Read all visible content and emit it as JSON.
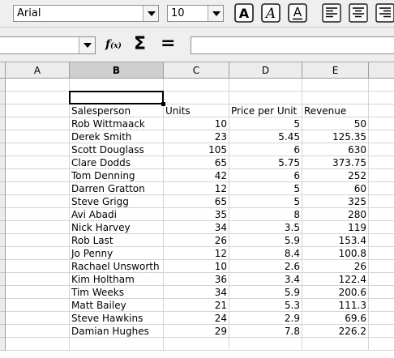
{
  "toolbar": {
    "font_name": "Arial",
    "font_size": "10",
    "bold_icon": "bold-icon",
    "italic_icon": "italic-icon",
    "underline_icon": "underline-icon",
    "bold_letter": "A",
    "italic_letter": "A",
    "underline_letter": "A"
  },
  "formula_bar": {
    "name_box_value": "",
    "function_wizard_label": "f(x)",
    "sum_label": "Σ",
    "equals_label": "=",
    "input_value": ""
  },
  "columns": [
    "A",
    "B",
    "C",
    "D",
    "E"
  ],
  "selected_column": "B",
  "headers": {
    "salesperson": "Salesperson",
    "units": "Units",
    "price": "Price per Unit",
    "revenue": "Revenue"
  },
  "rows": [
    {
      "name": "Rob Wittmaack",
      "units": "10",
      "price": "5",
      "revenue": "50"
    },
    {
      "name": "Derek Smith",
      "units": "23",
      "price": "5.45",
      "revenue": "125.35"
    },
    {
      "name": "Scott Douglass",
      "units": "105",
      "price": "6",
      "revenue": "630"
    },
    {
      "name": "Clare Dodds",
      "units": "65",
      "price": "5.75",
      "revenue": "373.75"
    },
    {
      "name": "Tom Denning",
      "units": "42",
      "price": "6",
      "revenue": "252"
    },
    {
      "name": "Darren Gratton",
      "units": "12",
      "price": "5",
      "revenue": "60"
    },
    {
      "name": "Steve Grigg",
      "units": "65",
      "price": "5",
      "revenue": "325"
    },
    {
      "name": "Avi Abadi",
      "units": "35",
      "price": "8",
      "revenue": "280"
    },
    {
      "name": "Nick Harvey",
      "units": "34",
      "price": "3.5",
      "revenue": "119"
    },
    {
      "name": "Rob Last",
      "units": "26",
      "price": "5.9",
      "revenue": "153.4"
    },
    {
      "name": "Jo Penny",
      "units": "12",
      "price": "8.4",
      "revenue": "100.8"
    },
    {
      "name": "Rachael Unsworth",
      "units": "10",
      "price": "2.6",
      "revenue": "26"
    },
    {
      "name": "Kim Holtham",
      "units": "36",
      "price": "3.4",
      "revenue": "122.4"
    },
    {
      "name": "Tim Weeks",
      "units": "34",
      "price": "5.9",
      "revenue": "200.6"
    },
    {
      "name": "Matt Bailey",
      "units": "21",
      "price": "5.3",
      "revenue": "111.3"
    },
    {
      "name": "Steve Hawkins",
      "units": "24",
      "price": "2.9",
      "revenue": "69.6"
    },
    {
      "name": "Damian Hughes",
      "units": "29",
      "price": "7.8",
      "revenue": "226.2"
    }
  ],
  "squiggle_words": [
    "Wittmaack",
    "Gratton",
    "Grigg",
    "Avi",
    "Abadi",
    "Rachael",
    "Unsworth",
    "Holtham"
  ]
}
